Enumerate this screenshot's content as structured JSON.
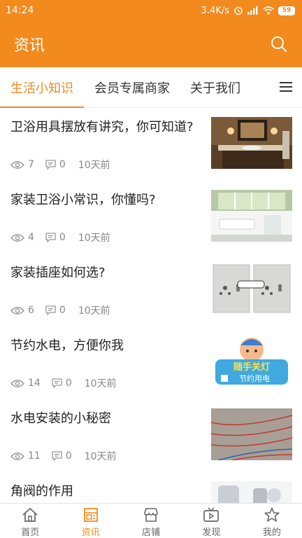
{
  "status": {
    "time": "14:24",
    "speed": "3.4K/s",
    "battery": "59"
  },
  "header": {
    "title": "资讯"
  },
  "tabs": [
    {
      "label": "生活小知识",
      "active": true
    },
    {
      "label": "会员专属商家",
      "active": false
    },
    {
      "label": "关于我们",
      "active": false
    }
  ],
  "articles": [
    {
      "title": "卫浴用具摆放有讲究，你可知道?",
      "views": "7",
      "comments": "0",
      "time": "10天前",
      "image": "bathroom-vanity-photo"
    },
    {
      "title": "家装卫浴小常识，你懂吗?",
      "views": "4",
      "comments": "0",
      "time": "10天前",
      "image": "bathroom-window-photo"
    },
    {
      "title": "家装插座如何选?",
      "views": "6",
      "comments": "0",
      "time": "10天前",
      "image": "wall-sockets-photo"
    },
    {
      "title": "节约水电，方便你我",
      "views": "14",
      "comments": "0",
      "time": "10天前",
      "image": "cartoon-save-power-image",
      "image_text": [
        "随手关灯",
        "节约用电"
      ]
    },
    {
      "title": "水电安装的小秘密",
      "views": "11",
      "comments": "0",
      "time": "10天前",
      "image": "floor-wiring-photo"
    },
    {
      "title": "角阀的作用",
      "views": "",
      "comments": "",
      "time": "",
      "image": "angle-valve-photo"
    }
  ],
  "bottom_nav": [
    {
      "label": "首页",
      "icon": "home-icon",
      "active": false
    },
    {
      "label": "资讯",
      "icon": "news-icon",
      "active": true
    },
    {
      "label": "店铺",
      "icon": "shop-icon",
      "active": false
    },
    {
      "label": "发现",
      "icon": "discover-tv-icon",
      "active": false
    },
    {
      "label": "我的",
      "icon": "star-icon",
      "active": false
    }
  ],
  "colors": {
    "accent": "#f28a1e",
    "text": "#222222",
    "meta": "#888888"
  }
}
